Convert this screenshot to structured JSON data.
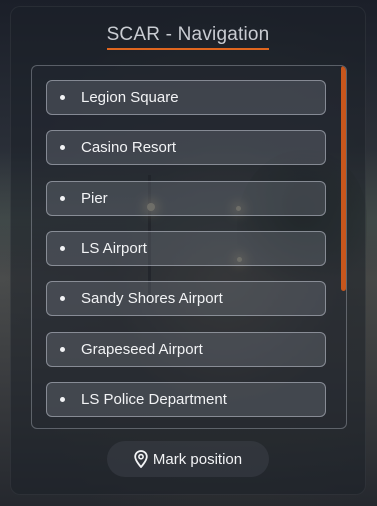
{
  "header": {
    "title": "SCAR - Navigation"
  },
  "locations": [
    {
      "label": "Legion Square"
    },
    {
      "label": "Casino Resort"
    },
    {
      "label": "Pier"
    },
    {
      "label": "LS Airport"
    },
    {
      "label": "Sandy Shores Airport"
    },
    {
      "label": "Grapeseed Airport"
    },
    {
      "label": "LS Police Department"
    }
  ],
  "actions": {
    "mark_position_label": "Mark position",
    "mark_position_icon": "map-pin-icon"
  },
  "colors": {
    "accent": "#e0661f",
    "scrollbar": "#c8561c",
    "text": "#f2f3f5"
  }
}
